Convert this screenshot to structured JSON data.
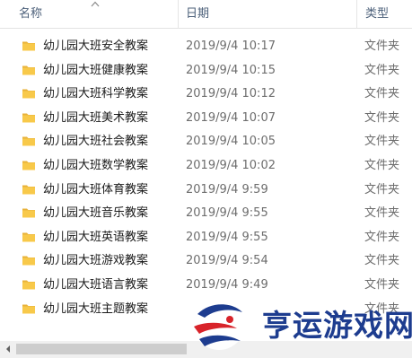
{
  "header": {
    "name_label": "名称",
    "date_label": "日期",
    "type_label": "类型",
    "sort_column": "name",
    "sort_direction": "ascending"
  },
  "rows": [
    {
      "name": "幼儿园大班安全教案",
      "date": "2019/9/4 10:17",
      "type": "文件夹"
    },
    {
      "name": "幼儿园大班健康教案",
      "date": "2019/9/4 10:15",
      "type": "文件夹"
    },
    {
      "name": "幼儿园大班科学教案",
      "date": "2019/9/4 10:12",
      "type": "文件夹"
    },
    {
      "name": "幼儿园大班美术教案",
      "date": "2019/9/4 10:07",
      "type": "文件夹"
    },
    {
      "name": "幼儿园大班社会教案",
      "date": "2019/9/4 10:05",
      "type": "文件夹"
    },
    {
      "name": "幼儿园大班数学教案",
      "date": "2019/9/4 10:02",
      "type": "文件夹"
    },
    {
      "name": "幼儿园大班体育教案",
      "date": "2019/9/4 9:59",
      "type": "文件夹"
    },
    {
      "name": "幼儿园大班音乐教案",
      "date": "2019/9/4 9:55",
      "type": "文件夹"
    },
    {
      "name": "幼儿园大班英语教案",
      "date": "2019/9/4 9:55",
      "type": "文件夹"
    },
    {
      "name": "幼儿园大班游戏教案",
      "date": "2019/9/4 9:54",
      "type": "文件夹"
    },
    {
      "name": "幼儿园大班语言教案",
      "date": "2019/9/4 9:49",
      "type": "文件夹"
    },
    {
      "name": "幼儿园大班主题教案",
      "date": "",
      "type": "文件夹"
    }
  ],
  "icons": {
    "folder": "folder-icon",
    "sort": "sort-ascending-icon",
    "scroll_left": "chevron-left-icon"
  },
  "colors": {
    "header_text": "#4c607a",
    "folder_yellow": "#f8c94a",
    "watermark_blue": "#1d3c8f",
    "watermark_red": "#d8232a"
  },
  "watermark": {
    "text": "亨运游戏网"
  }
}
